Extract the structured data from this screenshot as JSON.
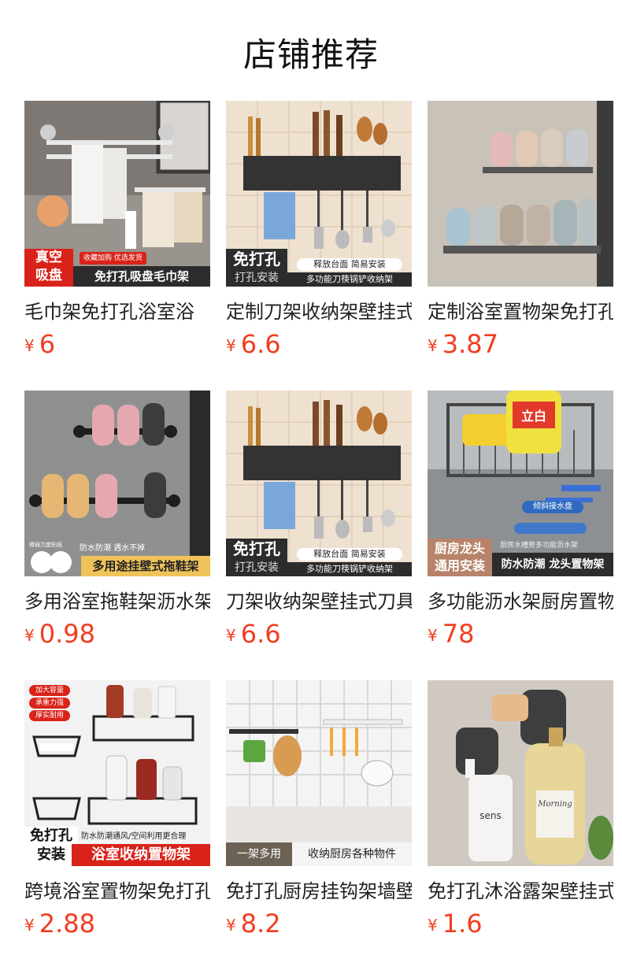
{
  "page": {
    "title": "店铺推荐"
  },
  "currency": "¥",
  "products": [
    {
      "name": "毛巾架免打孔浴室浴",
      "price": "6",
      "overlay": {
        "badge": "真空\n吸盘",
        "top": "收藏加购 优选发货",
        "main": "免打孔吸盘毛巾架"
      }
    },
    {
      "name": "定制刀架收纳架壁挂式",
      "price": "6.6",
      "overlay": {
        "badge_a": "免打孔",
        "badge_b": "打孔安装",
        "line1": "释放台面 简易安装",
        "line2": "多功能刀筷锅铲收纳架"
      }
    },
    {
      "name": "定制浴室置物架免打孔",
      "price": "3.87",
      "overlay": {}
    },
    {
      "name": "多用浴室拖鞋架沥水架",
      "price": "0.98",
      "overlay": {
        "small": "微弱力度贴纸",
        "top": "防水防潮 遇水不掉",
        "main": "多用途挂壁式拖鞋架"
      }
    },
    {
      "name": "刀架收纳架壁挂式刀具",
      "price": "6.6",
      "overlay": {
        "badge_a": "免打孔",
        "badge_b": "打孔安装",
        "line1": "释放台面 简易安装",
        "line2": "多功能刀筷锅铲收纳架"
      }
    },
    {
      "name": "多功能沥水架厨房置物",
      "price": "78",
      "overlay": {
        "tilt": "倾斜接水盘",
        "badge": "厨房龙头\n通用安装",
        "top": "厨房水槽旁多功能沥水架",
        "main": "防水防潮 龙头置物架",
        "bottle": "立白"
      }
    },
    {
      "name": "跨境浴室置物架免打孔",
      "price": "2.88",
      "overlay": {
        "chips": [
          "加大容量",
          "承重力强",
          "厚实耐用"
        ],
        "badge": "免打孔\n安装",
        "top": "防水防潮通风/空间利用更合理",
        "main": "浴室收纳置物架"
      }
    },
    {
      "name": "免打孔厨房挂钩架墙壁",
      "price": "8.2",
      "overlay": {
        "left": "一架多用",
        "right": "收纳厨房各种物件"
      }
    },
    {
      "name": "免打孔沐浴露架壁挂式",
      "price": "1.6",
      "overlay": {
        "bottle_a": "sens",
        "bottle_b": "Morning"
      }
    }
  ]
}
